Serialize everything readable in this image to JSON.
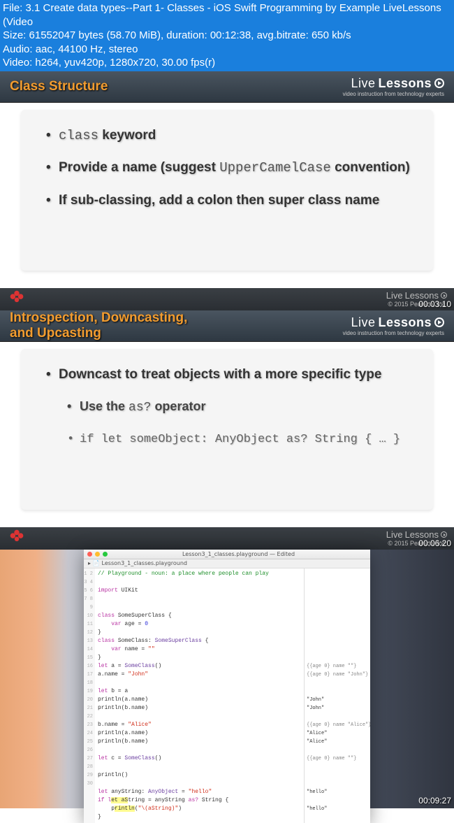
{
  "meta": {
    "file": "File: 3.1 Create data types--Part 1- Classes - iOS Swift Programming by Example LiveLessons (Video",
    "size": "Size: 61552047 bytes (58.70 MiB), duration: 00:12:38, avg.bitrate: 650 kb/s",
    "audio": "Audio: aac, 44100 Hz, stereo",
    "video": "Video: h264, yuv420p, 1280x720, 30.00 fps(r)"
  },
  "brand": {
    "name_a": "Live",
    "name_b": "Lessons",
    "tagline": "video instruction from technology experts",
    "copy": "© 2015 Pearson, Inc."
  },
  "slide1": {
    "title": "Class Structure",
    "b1_a": "class",
    "b1_b": " keyword",
    "b2_a": "Provide a name (suggest ",
    "b2_code": "UpperCamelCase",
    "b2_b": " convention)",
    "b3": "If sub-classing, add a colon then super class name",
    "ts": "00:03:10"
  },
  "slide2": {
    "title_a": "Introspection, Downcasting,",
    "title_b": "and Upcasting",
    "b1": "Downcast to treat objects with a more specific type",
    "b2_a": "Use the ",
    "b2_code": "as?",
    "b2_b": " operator",
    "b3": "if let someObject: AnyObject as? String { … }",
    "ts": "00:06:20"
  },
  "xcode": {
    "wintitle": "Lesson3_1_classes.playground — Edited",
    "tab": "Lesson3_1_classes.playground",
    "lines": [
      "1",
      "2",
      "3",
      "4",
      "5",
      "6",
      "7",
      "8",
      "9",
      "10",
      "11",
      "12",
      "13",
      "14",
      "15",
      "16",
      "17",
      "18",
      "19",
      "20",
      "21",
      "22",
      "23",
      "24",
      "25",
      "26",
      "27",
      "28",
      "29",
      "30"
    ],
    "code": {
      "l1": "// Playground - noun: a place where people can play",
      "l3a": "import",
      "l3b": " UIKit",
      "l6a": "class",
      "l6b": " SomeSuperClass {",
      "l7a": "    var",
      "l7b": " age = ",
      "l7c": "0",
      "l8": "}",
      "l9a": "class",
      "l9b": " SomeClass: ",
      "l9c": "SomeSuperClass",
      "l9d": " {",
      "l10a": "    var",
      "l10b": " name = ",
      "l10c": "\"\"",
      "l11": "}",
      "l12a": "let",
      "l12b": " a = ",
      "l12c": "SomeClass",
      "l12d": "()",
      "l13a": "a.name = ",
      "l13b": "\"John\"",
      "l15a": "let",
      "l15b": " b = a",
      "l16": "println(a.name)",
      "l17": "println(b.name)",
      "l19a": "b.name = ",
      "l19b": "\"Alice\"",
      "l20": "println(a.name)",
      "l21": "println(b.name)",
      "l23a": "let",
      "l23b": " c = ",
      "l23c": "SomeClass",
      "l23d": "()",
      "l25": "println()",
      "l27a": "let",
      "l27b": " anyString: ",
      "l27c": "AnyObject",
      "l27d": " = ",
      "l27e": "\"hello\"",
      "l28a": "if l",
      "l28hl": "et aS",
      "l28b": "tring = anyString ",
      "l28c": "as?",
      "l28d": " String {",
      "l29a": "    p",
      "l29hl": "rintln",
      "l29b": "(",
      "l29c": "\"\\(aString)\"",
      "l29d": ")",
      "l30": "}"
    },
    "results": {
      "r12": "{{age 0} name \"\"}",
      "r13": "{{age 0} name \"John\"}",
      "r16": "\"John\"",
      "r17": "\"John\"",
      "r19": "{{age 0} name \"Alice\"}",
      "r20": "\"Alice\"",
      "r21": "\"Alice\"",
      "r23": "{{age 0} name \"\"}",
      "r27": "\"hello\"",
      "r29": "\"hello\""
    },
    "ts": "00:09:27"
  }
}
